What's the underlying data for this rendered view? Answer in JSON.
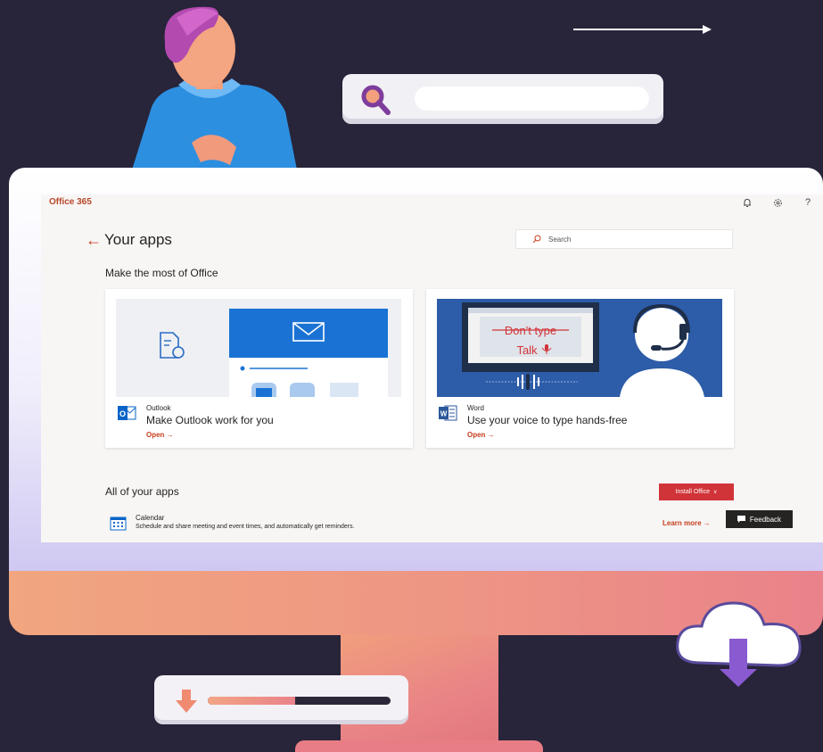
{
  "header": {
    "brand": "Office 365",
    "icons": [
      "bell-icon",
      "gear-icon",
      "help-icon"
    ],
    "help_glyph": "?"
  },
  "page": {
    "title": "Your apps",
    "search_placeholder": "Search"
  },
  "featured": {
    "heading": "Make the most of Office",
    "cards": [
      {
        "app": "Outlook",
        "tagline": "Make Outlook work for you",
        "link": "Open"
      },
      {
        "app": "Word",
        "tagline": "Use your voice to type hands-free",
        "link": "Open",
        "banner_strike": "Don't type",
        "banner_talk": "Talk"
      }
    ]
  },
  "all_apps": {
    "heading": "All of your apps",
    "install_label": "Install Office",
    "items": [
      {
        "name": "Calendar",
        "description": "Schedule and share meeting and event times, and automatically get reminders.",
        "link": "Learn more"
      }
    ]
  },
  "feedback_label": "Feedback",
  "illustration": {
    "download_progress": 0.48
  },
  "colors": {
    "office_accent": "#c43e1c",
    "install_button": "#d13438",
    "background": "#28243a"
  }
}
